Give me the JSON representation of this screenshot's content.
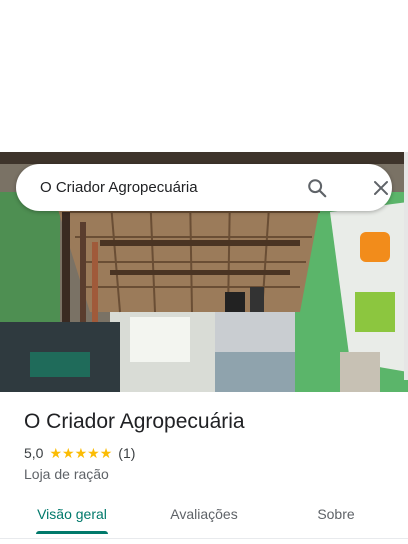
{
  "search": {
    "query": "O Criador Agropecuária"
  },
  "place": {
    "name": "O Criador Agropecuária",
    "rating": "5,0",
    "stars": 5,
    "review_count": "(1)",
    "category": "Loja de ração"
  },
  "tabs": [
    {
      "label": "Visão geral",
      "active": true
    },
    {
      "label": "Avaliações",
      "active": false
    },
    {
      "label": "Sobre",
      "active": false
    }
  ],
  "colors": {
    "accent": "#00796b",
    "star": "#fbbc04"
  },
  "icons": {
    "search": "search-icon",
    "close": "close-icon",
    "star": "star-icon"
  }
}
